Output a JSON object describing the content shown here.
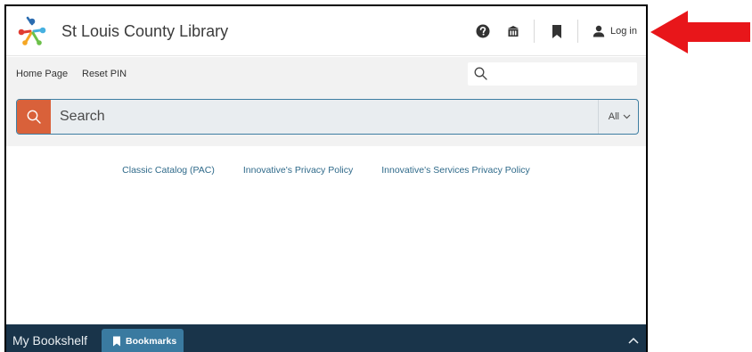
{
  "header": {
    "title": "St Louis County Library",
    "icons": [
      "help-icon",
      "library-building-icon",
      "bookmark-icon",
      "user-icon"
    ],
    "login_label": "Log in"
  },
  "subnav": {
    "items": [
      {
        "label": "Home Page"
      },
      {
        "label": "Reset PIN"
      }
    ],
    "search_placeholder": ""
  },
  "search": {
    "placeholder": "Search",
    "scope": "All"
  },
  "footer_links": [
    {
      "label": "Classic Catalog (PAC)"
    },
    {
      "label": "Innovative's Privacy Policy"
    },
    {
      "label": "Innovative's Services Privacy Policy"
    }
  ],
  "bookshelf": {
    "title": "My Bookshelf",
    "tab_label": "Bookmarks"
  },
  "colors": {
    "accent": "#d9613a",
    "link": "#2f6a8a",
    "bookshelf_bg": "#19344a",
    "annotation_arrow": "#e8161a"
  }
}
